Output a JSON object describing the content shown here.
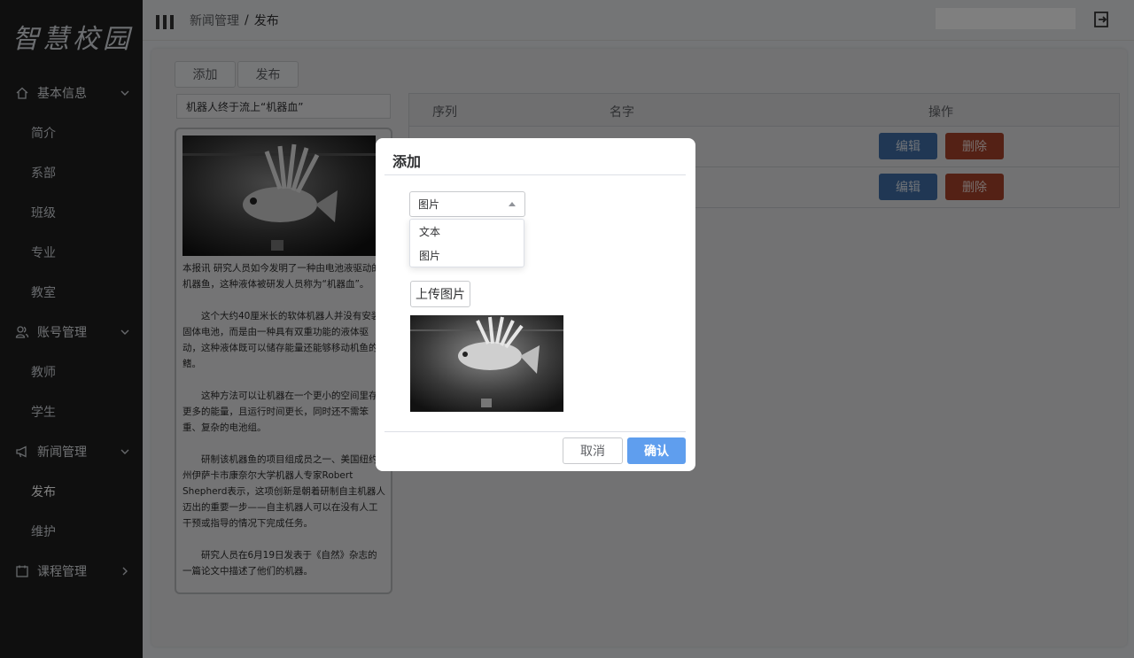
{
  "logo": "智慧校园",
  "sidebar": {
    "groups": [
      {
        "label": "基本信息",
        "icon": "home-icon",
        "items": [
          "简介",
          "系部",
          "班级",
          "专业",
          "教室"
        ]
      },
      {
        "label": "账号管理",
        "icon": "users-icon",
        "items": [
          "教师",
          "学生"
        ]
      },
      {
        "label": "新闻管理",
        "icon": "megaphone-icon",
        "items": [
          "发布",
          "维护"
        ]
      },
      {
        "label": "课程管理",
        "icon": "calendar-icon",
        "items": []
      }
    ]
  },
  "header": {
    "breadcrumb": [
      "新闻管理",
      "发布"
    ],
    "separator": "/"
  },
  "toolbar": {
    "add_label": "添加",
    "publish_label": "发布"
  },
  "news_title_value": "机器人终于流上“机器血”",
  "preview": {
    "paragraphs": [
      "本报讯 研究人员如今发明了一种由电池液驱动的机器鱼，这种液体被研发人员称为“机器血”。",
      "这个大约40厘米长的软体机器人并没有安装固体电池，而是由一种具有双重功能的液体驱动，这种液体既可以储存能量还能够移动机鱼的鳍。",
      "这种方法可以让机器在一个更小的空间里存更多的能量，且运行时间更长，同时还不需笨重、复杂的电池组。",
      "研制该机器鱼的项目组成员之一、美国纽约州伊萨卡市康奈尔大学机器人专家Robert Shepherd表示，这项创新是朝着研制自主机器人迈出的重要一步——自主机器人可以在没有人工干预或指导的情况下完成任务。",
      "研究人员在6月19日发表于《自然》杂志的一篇论文中描述了他们的机器。"
    ]
  },
  "table": {
    "columns": [
      "序列",
      "名字",
      "操作"
    ],
    "rows": [
      {
        "edit_label": "编辑",
        "delete_label": "删除"
      },
      {
        "edit_label": "编辑",
        "delete_label": "删除"
      }
    ]
  },
  "dialog": {
    "title": "添加",
    "select_value": "图片",
    "options": [
      "文本",
      "图片"
    ],
    "upload_label": "上传图片",
    "cancel_label": "取消",
    "confirm_label": "确认"
  },
  "colors": {
    "sidebar_bg": "#1f1f1f",
    "edit_button": "#406fa9",
    "delete_button": "#a8432b",
    "confirm_button": "#5f9eee"
  }
}
